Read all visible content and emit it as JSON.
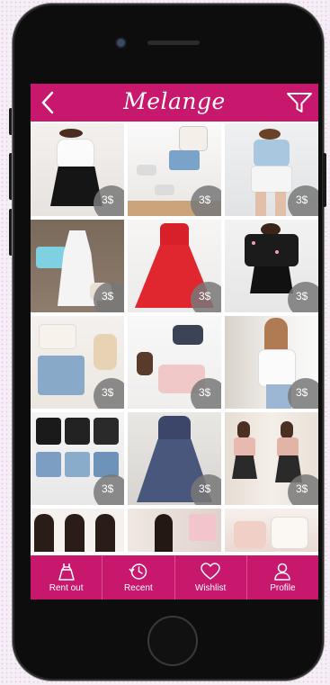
{
  "app": {
    "title": "Melange"
  },
  "topbar": {
    "back_icon": "chevron-left-icon",
    "filter_icon": "filter-icon"
  },
  "products": [
    {
      "price": "3$"
    },
    {
      "price": "3$"
    },
    {
      "price": "3$"
    },
    {
      "price": "3$"
    },
    {
      "price": "3$"
    },
    {
      "price": "3$"
    },
    {
      "price": "3$"
    },
    {
      "price": "3$"
    },
    {
      "price": "3$"
    },
    {
      "price": "3$"
    },
    {
      "price": "3$"
    },
    {
      "price": "3$"
    }
  ],
  "bottom_nav": [
    {
      "label": "Rent out",
      "icon": "dress-icon"
    },
    {
      "label": "Recent",
      "icon": "history-icon"
    },
    {
      "label": "Wishlist",
      "icon": "heart-icon"
    },
    {
      "label": "Profile",
      "icon": "user-icon"
    }
  ],
  "colors": {
    "accent": "#c8186d",
    "price_badge": "#787878"
  }
}
